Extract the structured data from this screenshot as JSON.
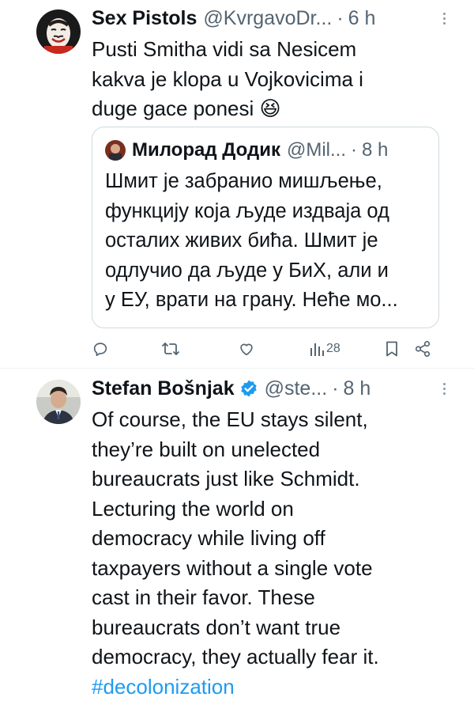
{
  "tweets": [
    {
      "author": "Sex Pistols",
      "handle": "@KvrgavoDr...",
      "time": "6 h",
      "text": "Pusti Smitha vidi sa Nesicem\nkakva je klopa u Vojkovicima i\nduge gace ponesi 😆",
      "quote": {
        "author": "Милорад Додик",
        "handle": "@Mil...",
        "time": "8 h",
        "text": "Шмит је забранио мишљење,\nфункцију која људе издваја од\nосталих живих бића. Шмит је\nодлучио да људе у БиХ, али и\nу ЕУ, врати на грану. Неће мо..."
      },
      "actions": {
        "reply_icon": "reply-icon",
        "retweet_icon": "retweet-icon",
        "like_icon": "like-icon",
        "views_icon": "views-icon",
        "views_count": "28",
        "bookmark_icon": "bookmark-icon",
        "share_icon": "share-icon"
      }
    },
    {
      "author": "Stefan Bošnjak",
      "handle": "@ste...",
      "time": "8 h",
      "verified": true,
      "text": "Of course, the EU stays silent,\nthey’re built on unelected\nbureaucrats just like Schmidt.\nLecturing the world on\ndemocracy while living off\ntaxpayers without a single vote\ncast in their favor. These\nbureaucrats don’t want true\ndemocracy, they actually fear it.",
      "hashtag": "#decolonization"
    }
  ],
  "separator": "·",
  "colors": {
    "text": "#0f1419",
    "secondary": "#536471",
    "link": "#1d9bf0",
    "border": "#cfd9de",
    "divider": "#eff3f4"
  }
}
